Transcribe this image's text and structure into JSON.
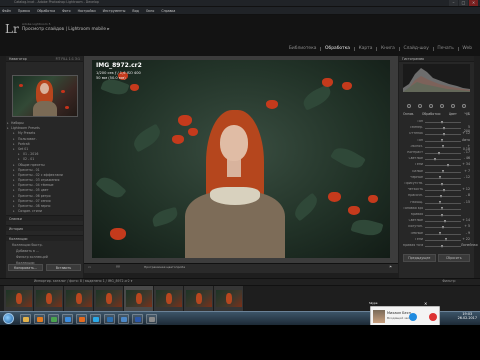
{
  "window": {
    "title": "Catalog.lrcat - Adobe Photoshop Lightroom - Develop",
    "controls": [
      "–",
      "□",
      "✕"
    ]
  },
  "menu": [
    "Файл",
    "Правка",
    "Обработка",
    "Фото",
    "Настройки",
    "Инструменты",
    "Вид",
    "Окно",
    "Справка"
  ],
  "identity": {
    "logo": "Lr",
    "catalog_line": "Adobe Lightroom 5",
    "subtitle": "Просмотр слайдов | Lightroom mobile ▸"
  },
  "modules": [
    {
      "label": "Библиотека",
      "active": false
    },
    {
      "label": "Обработка",
      "active": true
    },
    {
      "label": "Карта",
      "active": false
    },
    {
      "label": "Книга",
      "active": false
    },
    {
      "label": "Слайд-шоу",
      "active": false
    },
    {
      "label": "Печать",
      "active": false
    },
    {
      "label": "Web",
      "active": false
    }
  ],
  "left_panel": {
    "navigator_label": "Навигатор",
    "navigator_zoom": "FIT  FILL  1:1  3:1",
    "presets": [
      {
        "label": "Наборы",
        "level": 0
      },
      {
        "label": "Lightroom Presets",
        "level": 0
      },
      {
        "label": "My Presets",
        "level": 1
      },
      {
        "label": "Пользоват.",
        "level": 1
      },
      {
        "label": "Portrait",
        "level": 1
      },
      {
        "label": "Set 01",
        "level": 1
      },
      {
        "label": "01 - 2016",
        "level": 2
      },
      {
        "label": "02 - 01",
        "level": 2
      },
      {
        "label": "Общие пресеты",
        "level": 1
      },
      {
        "label": "Пресеты - 01",
        "level": 1
      },
      {
        "label": "Пресеты - 02 с эффектами",
        "level": 1
      },
      {
        "label": "Пресеты - 03 отражения",
        "level": 1
      },
      {
        "label": "Пресеты - 04 тёмные",
        "level": 1
      },
      {
        "label": "Пресеты - 05 цвет",
        "level": 1
      },
      {
        "label": "Пресеты - 06 ретро",
        "level": 1
      },
      {
        "label": "Пресеты - 07 сепия",
        "level": 1
      },
      {
        "label": "Пресеты - 08 зерно",
        "level": 1
      },
      {
        "label": "Создан. стили",
        "level": 1
      }
    ],
    "sections": {
      "snapshots": "Снимки",
      "history": "История",
      "collections": "Коллекции"
    },
    "collection_items": [
      "Коллекции быстр.",
      "Добавить в ...",
      "Фильтр коллекций",
      "Коллекции"
    ],
    "buttons": {
      "copy": "Копировать...",
      "paste": "Вставить"
    }
  },
  "photo_info": {
    "filename": "IMG_8972.cr2",
    "line1": "1/200 сек  ƒ / 1,6  ISO 400",
    "line2": "50 мм (50.0 мм)"
  },
  "right_panel": {
    "histogram_label": "Гистограмма",
    "tabs": [
      "Основ.",
      "Обработка:",
      "Цвет",
      "Ч/Б"
    ],
    "sliders": [
      {
        "label": "Тон",
        "value": "",
        "pos": 0.5
      },
      {
        "label": "Темпер.",
        "value": "5 200",
        "pos": 0.55
      },
      {
        "label": "Оттенок",
        "value": "+ 12",
        "pos": 0.54
      },
      {
        "label": "Тон",
        "value": "Авто",
        "pos": 0.5
      },
      {
        "label": "Экспоз.",
        "value": "+ 0,18",
        "pos": 0.52
      },
      {
        "label": "Контраст",
        "value": "- 17",
        "pos": 0.42
      },
      {
        "label": "Светлые",
        "value": "- 46",
        "pos": 0.3
      },
      {
        "label": "Тени",
        "value": "+ 34",
        "pos": 0.66
      },
      {
        "label": "Белые",
        "value": "+ 7",
        "pos": 0.53
      },
      {
        "label": "Чёрные",
        "value": "- 12",
        "pos": 0.44
      },
      {
        "label": "Присутств.",
        "value": "",
        "pos": 0.5
      },
      {
        "label": "Четкость",
        "value": "+ 12",
        "pos": 0.56
      },
      {
        "label": "Красочн.",
        "value": "- 8",
        "pos": 0.46
      },
      {
        "label": "Насыщ.",
        "value": "- 15",
        "pos": 0.43
      },
      {
        "label": "Тоновая кривая",
        "value": "",
        "pos": 0.5
      },
      {
        "label": "Кривая",
        "value": "",
        "pos": 0.5
      },
      {
        "label": "Светлые",
        "value": "+ 14",
        "pos": 0.57
      },
      {
        "label": "Полутон.",
        "value": "+ 5",
        "pos": 0.52
      },
      {
        "label": "Тёмные",
        "value": "- 9",
        "pos": 0.45
      },
      {
        "label": "Тени",
        "value": "+ 22",
        "pos": 0.61
      },
      {
        "label": "Кривая точек",
        "value": "Линейная",
        "pos": 0.5
      }
    ],
    "buttons": {
      "previous": "Предыдущее",
      "reset": "Сбросить"
    }
  },
  "toolbar": {
    "view": "▭",
    "yy": "YY",
    "soft_proof": "Программная цветопроба",
    "flag": "⚑"
  },
  "filmstrip": {
    "info": "Импортир. каталог  /  фото: 8  /  выделено 1 / IMG_8972.cr2 ▾",
    "filter": "Фильтр:",
    "count": 8,
    "selected_index": 4
  },
  "taskbar": {
    "time": "19:03",
    "date": "26.02.2017",
    "apps": [
      {
        "name": "explorer",
        "color": "#e2b24a"
      },
      {
        "name": "mediaplayer",
        "color": "#e37b1f"
      },
      {
        "name": "chrome",
        "color": "#4aa34f"
      },
      {
        "name": "ie",
        "color": "#3b8de0"
      },
      {
        "name": "firefox",
        "color": "#e36a1f"
      },
      {
        "name": "skype",
        "color": "#2aa9e8"
      },
      {
        "name": "photoshop",
        "color": "#2b6fb0"
      },
      {
        "name": "lightroom",
        "color": "#4c88c7"
      },
      {
        "name": "word",
        "color": "#2b57a8"
      },
      {
        "name": "app",
        "color": "#8a8a8a"
      }
    ]
  },
  "notification": {
    "header": "Skype",
    "caller": "Михаил Бесп...",
    "sub": "Входящий звонок",
    "accept": "✆",
    "decline": "✆",
    "close": "✕"
  },
  "colors": {
    "accent": "#ffffff",
    "panel": "#272727",
    "flower": "#c53a1c",
    "hair": "#b5461d"
  }
}
